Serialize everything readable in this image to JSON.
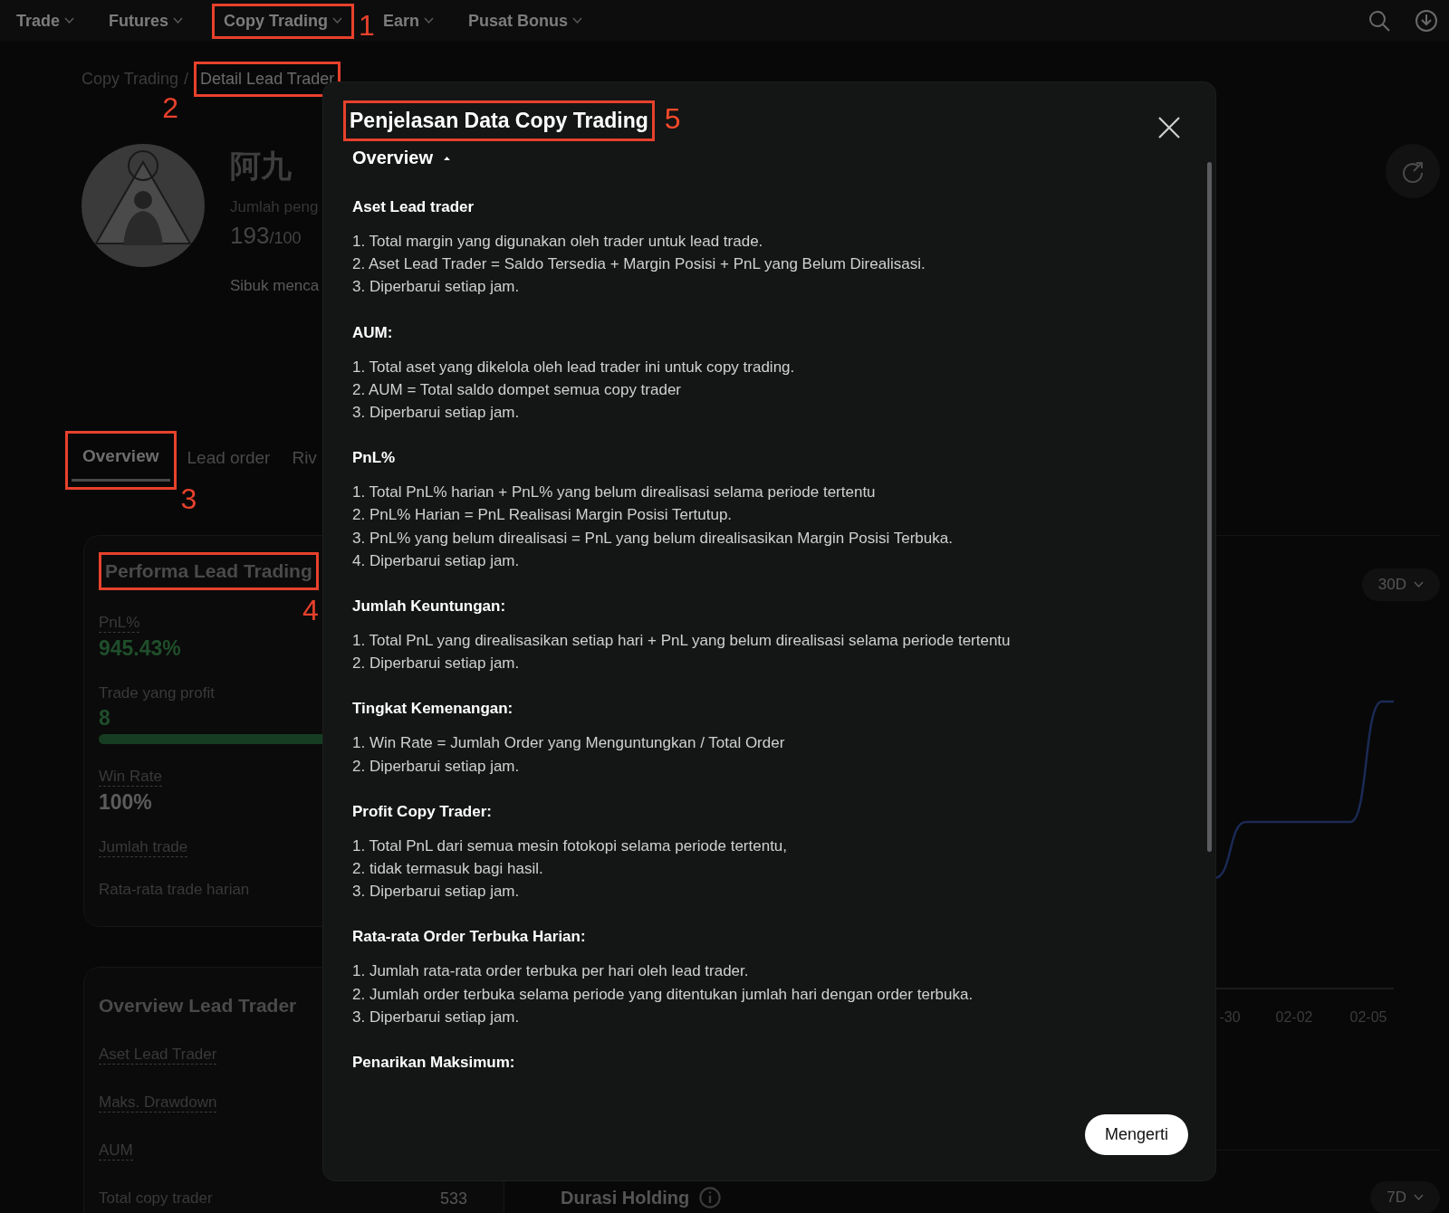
{
  "nav": {
    "items": [
      {
        "label": "Trade"
      },
      {
        "label": "Futures"
      },
      {
        "label": "Copy Trading",
        "callout": "1"
      },
      {
        "label": "Earn"
      },
      {
        "label": "Pusat Bonus"
      }
    ]
  },
  "breadcrumb": {
    "items": [
      {
        "label": "Copy Trading"
      },
      {
        "label": "Detail Lead Trader",
        "callout": "2"
      }
    ],
    "separator": "/"
  },
  "profile": {
    "name": "阿九",
    "followers_label": "Jumlah peng",
    "followers": "193",
    "followers_max": "/100",
    "bio": "Sibuk menca"
  },
  "tabs": [
    {
      "label": "Overview",
      "selected": true,
      "callout": "3"
    },
    {
      "label": "Lead order",
      "selected": false
    },
    {
      "label": "Riv",
      "selected": false
    }
  ],
  "performance": {
    "title": "Performa Lead Trading",
    "callout": "4",
    "stats": [
      {
        "label": "PnL%",
        "tooltip": true,
        "value": "945.43%",
        "color": "#1f4e2b"
      },
      {
        "label": "Trade yang profit",
        "tooltip": false,
        "value": "8",
        "color": "#1f4e2b",
        "level": 1
      },
      {
        "label": "Win Rate",
        "tooltip": true,
        "value": "100%",
        "color": "#5c5c5c"
      },
      {
        "label": "Jumlah trade",
        "tooltip": true
      },
      {
        "label": "Rata-rata trade harian",
        "tooltip": false
      }
    ]
  },
  "lead_overview": {
    "title": "Overview Lead Trader",
    "rows": [
      {
        "label": "Aset Lead Trader",
        "tooltip": true
      },
      {
        "label": "Maks. Drawdown",
        "tooltip": true
      },
      {
        "label": "AUM",
        "tooltip": true
      },
      {
        "label": "Total copy trader",
        "tooltip": false,
        "value": "533"
      }
    ]
  },
  "chart": {
    "period": "30D",
    "x_labels": [
      "-30",
      "02-02",
      "02-05"
    ]
  },
  "holding": {
    "title": "Durasi Holding",
    "period": "7D"
  },
  "modal": {
    "title": "Penjelasan Data Copy Trading",
    "callout": "5",
    "toggle": {
      "label": "Overview",
      "expanded": true
    },
    "sections": [
      {
        "heading": "Aset Lead trader",
        "items": [
          "1. Total margin yang digunakan oleh trader untuk lead trade.",
          "2. Aset Lead Trader = Saldo Tersedia + Margin Posisi + PnL yang Belum Direalisasi.",
          "3. Diperbarui setiap jam."
        ]
      },
      {
        "heading": "AUM:",
        "items": [
          "1. Total aset yang dikelola oleh lead trader ini untuk copy trading.",
          "2. AUM = Total saldo dompet semua copy trader",
          "3. Diperbarui setiap jam."
        ]
      },
      {
        "heading": "PnL%",
        "items": [
          "1. Total PnL% harian + PnL% yang belum direalisasi selama periode tertentu",
          "2. PnL% Harian = PnL Realisasi Margin Posisi Tertutup.",
          "3. PnL% yang belum direalisasi = PnL yang belum direalisasikan Margin Posisi Terbuka.",
          "4. Diperbarui setiap jam."
        ]
      },
      {
        "heading": "Jumlah Keuntungan:",
        "items": [
          "1. Total PnL yang direalisasikan setiap hari + PnL yang belum direalisasi selama periode tertentu",
          "2. Diperbarui setiap jam."
        ]
      },
      {
        "heading": "Tingkat Kemenangan:",
        "items": [
          "1. Win Rate = Jumlah Order yang Menguntungkan / Total Order",
          "2. Diperbarui setiap jam."
        ]
      },
      {
        "heading": "Profit Copy Trader:",
        "items": [
          "1. Total PnL dari semua mesin fotokopi selama periode tertentu,",
          "2. tidak termasuk bagi hasil.",
          "3. Diperbarui setiap jam."
        ]
      },
      {
        "heading": "Rata-rata Order Terbuka Harian:",
        "items": [
          "1. Jumlah rata-rata order terbuka per hari oleh lead trader.",
          "2. Jumlah order terbuka selama periode yang ditentukan jumlah hari dengan order terbuka.",
          "3. Diperbarui setiap jam."
        ]
      },
      {
        "heading": "Penarikan Maksimum:"
      }
    ],
    "button": "Mengerti"
  }
}
